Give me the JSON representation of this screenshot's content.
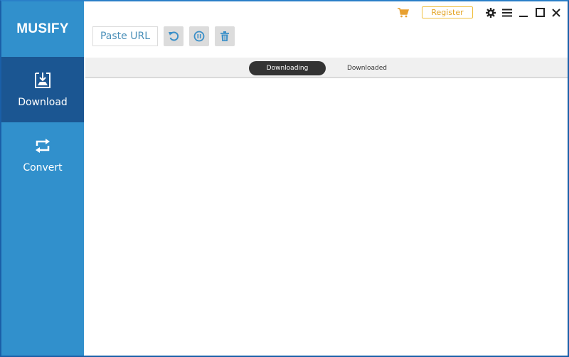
{
  "app": {
    "title": "MUSIFY"
  },
  "sidebar": {
    "items": [
      {
        "label": "Download",
        "icon": "download-icon",
        "active": true
      },
      {
        "label": "Convert",
        "icon": "convert-icon",
        "active": false
      }
    ]
  },
  "toolbar": {
    "paste_url_label": "Paste URL",
    "buttons": [
      {
        "icon": "refresh-icon"
      },
      {
        "icon": "pause-icon"
      },
      {
        "icon": "trash-icon"
      }
    ]
  },
  "titlebar": {
    "register_label": "Register",
    "icons": [
      "cart-icon",
      "gear-icon",
      "menu-icon",
      "minimize-icon",
      "maximize-icon",
      "close-icon"
    ]
  },
  "tabs": [
    {
      "label": "Downloading",
      "active": true
    },
    {
      "label": "Downloaded",
      "active": false
    }
  ],
  "colors": {
    "sidebar": "#3190cc",
    "sidebar_active": "#1b5692",
    "accent_orange": "#e3a322",
    "icon_blue": "#3a8fc8"
  }
}
